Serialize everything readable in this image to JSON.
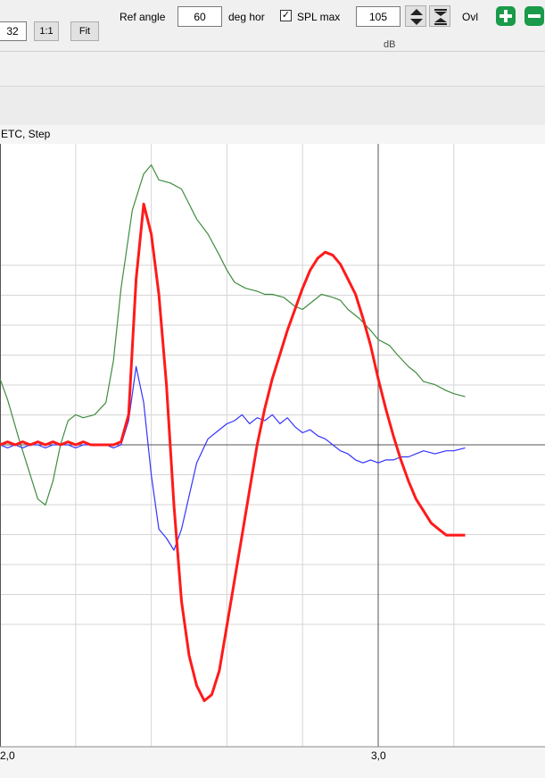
{
  "toolbar": {
    "zoom_value": "32",
    "one_to_one_label": "1:1",
    "fit_label": "Fit",
    "ref_angle_label": "Ref angle",
    "ref_angle_value": "60",
    "deg_hor_label": "deg hor",
    "spl_max_checked": true,
    "spl_max_label": "SPL max",
    "spl_max_value": "105",
    "ovl_label": "Ovl",
    "unit_label": "dB"
  },
  "plot": {
    "title": "ETC, Step",
    "x_ticks": [
      "2,0",
      "3,0"
    ]
  },
  "colors": {
    "red_trace": "#ff1a1a",
    "green_trace": "#3f8c3f",
    "blue_trace": "#3333ff",
    "add_button": "#1a9a4a"
  },
  "chart_data": {
    "type": "line",
    "title": "ETC, Step",
    "x_tick_labels": [
      "2,0",
      "3,0"
    ],
    "xlim": [
      2.0,
      3.23
    ],
    "ylim": [
      -1,
      1
    ],
    "grid": true,
    "series": [
      {
        "color": "#3f8c3f",
        "x": [
          2.0,
          2.02,
          2.05,
          2.08,
          2.1,
          2.12,
          2.14,
          2.16,
          2.18,
          2.2,
          2.22,
          2.25,
          2.28,
          2.3,
          2.32,
          2.35,
          2.38,
          2.4,
          2.42,
          2.45,
          2.48,
          2.5,
          2.52,
          2.55,
          2.58,
          2.6,
          2.62,
          2.65,
          2.68,
          2.7,
          2.72,
          2.75,
          2.78,
          2.8,
          2.82,
          2.85,
          2.88,
          2.9,
          2.92,
          2.95,
          2.98,
          3.0,
          3.03,
          3.05,
          3.08,
          3.1,
          3.12,
          3.15,
          3.18,
          3.2,
          3.23
        ],
        "y": [
          0.22,
          0.15,
          0.02,
          -0.1,
          -0.18,
          -0.2,
          -0.12,
          0.0,
          0.08,
          0.1,
          0.09,
          0.1,
          0.14,
          0.28,
          0.52,
          0.78,
          0.9,
          0.93,
          0.88,
          0.87,
          0.85,
          0.8,
          0.75,
          0.7,
          0.63,
          0.58,
          0.54,
          0.52,
          0.51,
          0.5,
          0.5,
          0.49,
          0.46,
          0.45,
          0.47,
          0.5,
          0.49,
          0.48,
          0.45,
          0.42,
          0.38,
          0.35,
          0.33,
          0.3,
          0.26,
          0.24,
          0.21,
          0.2,
          0.18,
          0.17,
          0.16
        ]
      },
      {
        "color": "#3333ff",
        "x": [
          2.0,
          2.02,
          2.04,
          2.06,
          2.08,
          2.1,
          2.12,
          2.14,
          2.16,
          2.18,
          2.2,
          2.22,
          2.24,
          2.26,
          2.28,
          2.3,
          2.32,
          2.34,
          2.36,
          2.38,
          2.4,
          2.42,
          2.44,
          2.46,
          2.48,
          2.5,
          2.52,
          2.55,
          2.58,
          2.6,
          2.62,
          2.64,
          2.66,
          2.68,
          2.7,
          2.72,
          2.74,
          2.76,
          2.78,
          2.8,
          2.82,
          2.84,
          2.86,
          2.88,
          2.9,
          2.92,
          2.94,
          2.96,
          2.98,
          3.0,
          3.02,
          3.04,
          3.06,
          3.08,
          3.1,
          3.12,
          3.15,
          3.18,
          3.2,
          3.23
        ],
        "y": [
          0.0,
          -0.01,
          0.0,
          -0.01,
          0.0,
          0.0,
          -0.01,
          0.0,
          0.0,
          0.0,
          -0.01,
          0.0,
          0.0,
          0.0,
          0.0,
          -0.01,
          0.0,
          0.08,
          0.26,
          0.14,
          -0.1,
          -0.28,
          -0.31,
          -0.35,
          -0.28,
          -0.17,
          -0.06,
          0.02,
          0.05,
          0.07,
          0.08,
          0.1,
          0.07,
          0.09,
          0.08,
          0.1,
          0.07,
          0.09,
          0.06,
          0.04,
          0.05,
          0.03,
          0.02,
          0.0,
          -0.02,
          -0.03,
          -0.05,
          -0.06,
          -0.05,
          -0.06,
          -0.05,
          -0.05,
          -0.04,
          -0.04,
          -0.03,
          -0.02,
          -0.03,
          -0.02,
          -0.02,
          -0.01
        ]
      },
      {
        "color": "#ff1a1a",
        "x": [
          2.0,
          2.02,
          2.04,
          2.06,
          2.08,
          2.1,
          2.12,
          2.14,
          2.16,
          2.18,
          2.2,
          2.22,
          2.24,
          2.26,
          2.28,
          2.3,
          2.32,
          2.34,
          2.36,
          2.38,
          2.4,
          2.42,
          2.44,
          2.46,
          2.48,
          2.5,
          2.52,
          2.54,
          2.56,
          2.58,
          2.6,
          2.62,
          2.64,
          2.66,
          2.68,
          2.7,
          2.72,
          2.74,
          2.76,
          2.78,
          2.8,
          2.82,
          2.84,
          2.86,
          2.88,
          2.9,
          2.92,
          2.94,
          2.96,
          2.98,
          3.0,
          3.02,
          3.04,
          3.06,
          3.08,
          3.1,
          3.12,
          3.14,
          3.16,
          3.18,
          3.2,
          3.23
        ],
        "y": [
          0.0,
          0.01,
          0.0,
          0.01,
          0.0,
          0.01,
          0.0,
          0.01,
          0.0,
          0.01,
          0.0,
          0.01,
          0.0,
          0.0,
          0.0,
          0.0,
          0.01,
          0.1,
          0.55,
          0.8,
          0.7,
          0.5,
          0.2,
          -0.2,
          -0.52,
          -0.7,
          -0.8,
          -0.85,
          -0.83,
          -0.75,
          -0.6,
          -0.45,
          -0.3,
          -0.15,
          0.0,
          0.12,
          0.22,
          0.3,
          0.38,
          0.45,
          0.52,
          0.58,
          0.62,
          0.64,
          0.63,
          0.6,
          0.55,
          0.5,
          0.42,
          0.33,
          0.22,
          0.12,
          0.03,
          -0.05,
          -0.12,
          -0.18,
          -0.22,
          -0.26,
          -0.28,
          -0.3,
          -0.3,
          -0.3
        ]
      }
    ]
  }
}
